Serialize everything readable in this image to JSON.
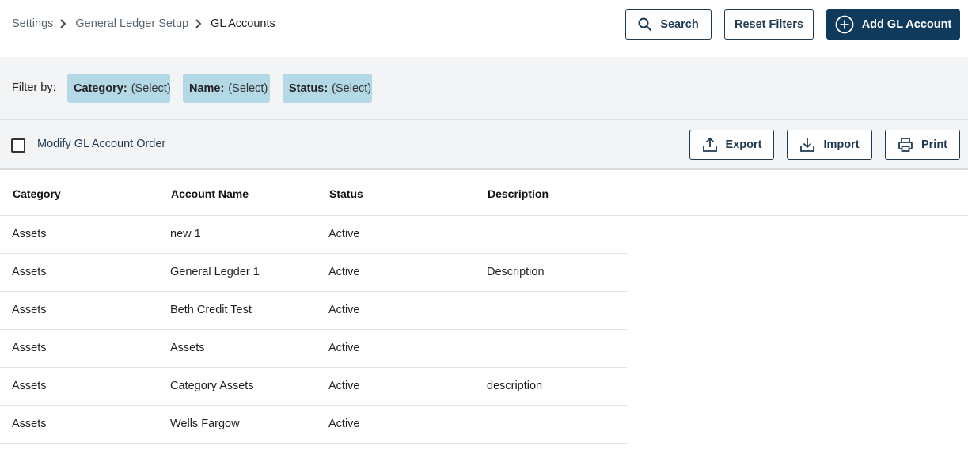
{
  "breadcrumb": {
    "items": [
      "Settings",
      "General Ledger Setup"
    ],
    "current": "GL Accounts"
  },
  "header": {
    "search_label": "Search",
    "reset_label": "Reset Filters",
    "add_label": "Add GL Account"
  },
  "filters": {
    "label": "Filter by:",
    "chips": [
      {
        "key": "Category:",
        "value": "(Select)"
      },
      {
        "key": "Name:",
        "value": "(Select)"
      },
      {
        "key": "Status:",
        "value": "(Select)"
      }
    ]
  },
  "toolbar": {
    "modify_order_label": "Modify GL Account Order",
    "modify_order_checked": false,
    "export_label": "Export",
    "import_label": "Import",
    "print_label": "Print"
  },
  "table": {
    "columns": [
      "Category",
      "Account Name",
      "Status",
      "Description"
    ],
    "rows": [
      [
        "Assets",
        "new 1",
        "Active",
        ""
      ],
      [
        "Assets",
        "General Legder 1",
        "Active",
        "Description"
      ],
      [
        "Assets",
        "Beth Credit Test",
        "Active",
        ""
      ],
      [
        "Assets",
        "Assets",
        "Active",
        ""
      ],
      [
        "Assets",
        "Category Assets",
        "Active",
        "description"
      ],
      [
        "Assets",
        "Wells Fargow",
        "Active",
        ""
      ]
    ]
  },
  "colors": {
    "primary": "#0f3a5c",
    "chip_bg": "#b3d9e6",
    "bar_bg": "#f3f4f6"
  }
}
